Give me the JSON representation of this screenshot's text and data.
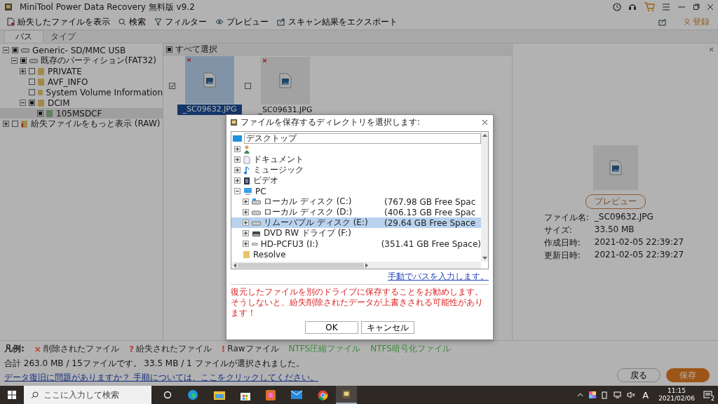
{
  "window": {
    "title": "MiniTool Power Data Recovery 無料版 v9.2"
  },
  "toolbar": [
    {
      "label": "紛失したファイルを表示",
      "kind": "file"
    },
    {
      "label": "検索",
      "kind": "search"
    },
    {
      "label": "フィルター",
      "kind": "filter"
    },
    {
      "label": "プレビュー",
      "kind": "eye"
    },
    {
      "label": "スキャン結果をエクスポート",
      "kind": "export"
    }
  ],
  "account": {
    "label": "登録"
  },
  "tabs": [
    {
      "label": "パス",
      "selected": true
    },
    {
      "label": "タイプ",
      "selected": false
    }
  ],
  "tree": [
    {
      "label": "Generic- SD/MMC USB",
      "kind": "drive",
      "checked": true,
      "expanded": true,
      "selected": false,
      "children": [
        {
          "label": "既存のパーティション(FAT32)",
          "kind": "drive",
          "checked": true,
          "expanded": true,
          "selected": false,
          "children": [
            {
              "label": "PRIVATE",
              "kind": "folder",
              "checked": false,
              "expanded": false,
              "selected": false
            },
            {
              "label": "AVF_INFO",
              "kind": "folder",
              "checked": false,
              "selected": false
            },
            {
              "label": "System Volume Information",
              "kind": "folder",
              "checked": false,
              "selected": false
            },
            {
              "label": "DCIM",
              "kind": "folder",
              "checked": true,
              "expanded": true,
              "selected": false,
              "children": [
                {
                  "label": "105MSDCF",
                  "kind": "photo-folder",
                  "checked": true,
                  "selected": true
                }
              ]
            }
          ]
        }
      ]
    },
    {
      "label": "紛失ファイルをもっと表示 (RAW)",
      "kind": "raw",
      "checked": false,
      "expanded": false,
      "selected": false
    }
  ],
  "select_all": {
    "label": "すべて選択",
    "checked": true
  },
  "files": [
    {
      "name": "_SC09632.JPG",
      "checked": true,
      "selected": true
    },
    {
      "name": "_SC09631.JPG",
      "checked": false,
      "selected": false
    }
  ],
  "details": {
    "preview_button": "プレビュー",
    "fields": [
      {
        "label": "ファイル名:",
        "value": "_SC09632.JPG"
      },
      {
        "label": "サイズ:",
        "value": "33.50 MB"
      },
      {
        "label": "作成日時:",
        "value": "2021-02-05 22:39:27"
      },
      {
        "label": "更新日時:",
        "value": "2021-02-05 22:39:27"
      }
    ]
  },
  "legend": {
    "label": "凡例:",
    "items": [
      {
        "mark": "×",
        "text": "削除されたファイル",
        "color": "#c0392b"
      },
      {
        "mark": "?",
        "text": "紛失されたファイル",
        "color": "#c0392b"
      },
      {
        "mark": "!",
        "text": "Rawファイル",
        "color": "#c0392b"
      },
      {
        "text": "NTFS圧縮ファイル",
        "color": "#3a8a3a"
      },
      {
        "text": "NTFS暗号化ファイル",
        "color": "#3a8a3a"
      }
    ]
  },
  "summary": "合計 263.0 MB / 15ファイルです。 33.5 MB / 1 ファイルが選択されました。",
  "help_link": "データ復旧に問題がありますか？ 手順については、ここをクリックしてください。",
  "buttons": {
    "back": "戻る",
    "save": "保存"
  },
  "dialog": {
    "title": "ファイルを保存するディレクトリを選択します:",
    "root": "デスクトップ",
    "items": [
      {
        "kind": "user",
        "expanded": false,
        "selected": false
      },
      {
        "label": "ドキュメント",
        "kind": "doc",
        "expanded": false,
        "selected": false
      },
      {
        "label": "ミュージック",
        "kind": "music",
        "expanded": false,
        "selected": false
      },
      {
        "label": "ビデオ",
        "kind": "video",
        "expanded": false,
        "selected": false
      },
      {
        "label": "PC",
        "kind": "pc",
        "expanded": true,
        "selected": false,
        "children": [
          {
            "label": "ローカル ディスク (C:)",
            "free": "(767.98 GB Free Spac",
            "kind": "sysdisk",
            "expanded": false,
            "selected": false
          },
          {
            "label": "ローカル ディスク (D:)",
            "free": "(406.13 GB Free Spac",
            "kind": "disk",
            "expanded": false,
            "selected": false
          },
          {
            "label": "リムーバブル ディスク (E:)",
            "free": "(29.64 GB Free Space",
            "kind": "disk",
            "expanded": false,
            "selected": true
          },
          {
            "label": "DVD RW ドライブ (F:)",
            "kind": "dvd",
            "expanded": false,
            "selected": false
          },
          {
            "label": "HD-PCFU3 (I:)",
            "free": "(351.41 GB Free Space)",
            "kind": "disk",
            "expanded": false,
            "selected": false
          }
        ]
      },
      {
        "label": "Resolve",
        "kind": "folder",
        "selected": false
      }
    ],
    "manual_link": "手動でパスを入力します。",
    "warning": "復元したファイルを別のドライブに保存することをお勧めします。そうしないと、紛失削除されたデータが上書きされる可能性があります！",
    "ok": "OK",
    "cancel": "キャンセル"
  },
  "taskbar": {
    "search_placeholder": "ここに入力して検索",
    "time": "11:15",
    "date": "2021/02/06",
    "ime": "A",
    "notifications": "2"
  }
}
